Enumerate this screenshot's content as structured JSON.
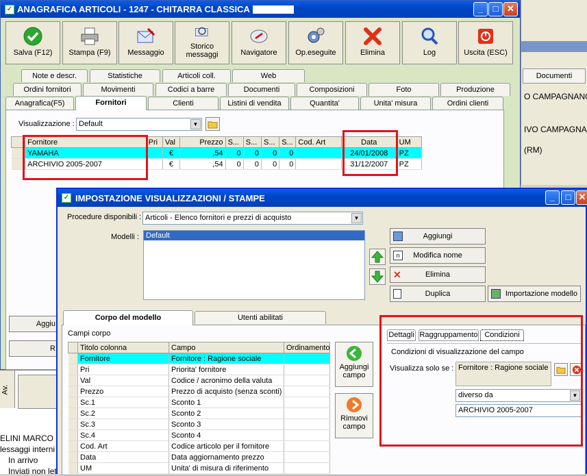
{
  "main_window": {
    "title": "ANAGRAFICA ARTICOLI - 1247 - CHITARRA CLASSICA",
    "toolbar": [
      {
        "label": "Salva (F12)",
        "icon": "check-icon"
      },
      {
        "label": "Stampa (F9)",
        "icon": "printer-icon"
      },
      {
        "label": "Messaggio",
        "icon": "envelope-pen-icon"
      },
      {
        "label": "Storico messaggi",
        "icon": "envelope-search-icon"
      },
      {
        "label": "Navigatore",
        "icon": "compass-icon"
      },
      {
        "label": "Op.eseguite",
        "icon": "gear-icon"
      },
      {
        "label": "Elimina",
        "icon": "x-icon"
      },
      {
        "label": "Log",
        "icon": "magnifier-icon"
      },
      {
        "label": "Uscita (ESC)",
        "icon": "power-icon"
      }
    ],
    "tabs_row1": [
      "Note e descr.",
      "Statistiche",
      "Articoli coll.",
      "Web"
    ],
    "tabs_row2": [
      "Ordini fornitori",
      "Movimenti",
      "Codici a barre",
      "Documenti",
      "Composizioni",
      "Foto",
      "Produzione"
    ],
    "tabs_row3": [
      "Anagrafica(F5)",
      "Fornitori",
      "Clienti",
      "Listini di vendita",
      "Quantita'",
      "Unita' misura",
      "Ordini clienti"
    ],
    "visualizzazione_label": "Visualizzazione :",
    "visualizzazione_value": "Default",
    "grid_headers": [
      "Fornitore",
      "Pri",
      "Val",
      "Prezzo",
      "S...",
      "S...",
      "S...",
      "S...",
      "Cod. Art",
      "Data",
      "UM"
    ],
    "grid_rows": [
      [
        "YAMAHA",
        "",
        "€",
        ",54",
        "0",
        "0",
        "0",
        "0",
        "",
        "24/01/2008",
        "PZ"
      ],
      [
        "ARCHIVIO 2005-2007",
        "",
        "€",
        ",54",
        "0",
        "0",
        "0",
        "0",
        "",
        "31/12/2007",
        "PZ"
      ]
    ],
    "side_buttons": [
      "Aggiu",
      "R"
    ]
  },
  "background_window": {
    "documenti_label": "Documenti",
    "lines": [
      "O CAMPAGNANO",
      "IVO CAMPAGNAN",
      "(RM)"
    ]
  },
  "bottom_left": {
    "av_label": "Av.",
    "lines": [
      "ELINI MARCO",
      "lessaggi interni",
      "In arrivo",
      "Inviati non letti"
    ]
  },
  "dialog": {
    "title": "IMPOSTAZIONE VISUALIZZAZIONI / STAMPE",
    "procedure_label": "Procedure disponibili :",
    "procedure_value": "Articoli - Elenco fornitori e prezzi di acquisto",
    "modelli_label": "Modelli :",
    "modelli_items": [
      "Default"
    ],
    "buttons": {
      "aggiungi": "Aggiungi",
      "modifica_nome": "Modifica nome",
      "elimina": "Elimina",
      "duplica": "Duplica",
      "importazione": "Importazione modello"
    },
    "tabs": [
      "Corpo del modello",
      "Utenti abilitati"
    ],
    "campi_corpo_label": "Campi corpo",
    "columns": [
      "Titolo colonna",
      "Campo",
      "Ordinamento"
    ],
    "rows": [
      [
        "Fornitore",
        "Fornitore : Ragione sociale",
        ""
      ],
      [
        "Pri",
        "Priorita' fornitore",
        ""
      ],
      [
        "Val",
        "Codice / acronimo della valuta",
        ""
      ],
      [
        "Prezzo",
        "Prezzo di acquisto (senza sconti)",
        ""
      ],
      [
        "Sc.1",
        "Sconto 1",
        ""
      ],
      [
        "Sc.2",
        "Sconto 2",
        ""
      ],
      [
        "Sc.3",
        "Sconto 3",
        ""
      ],
      [
        "Sc.4",
        "Sconto 4",
        ""
      ],
      [
        "Cod. Art",
        "Codice articolo per il fornitore",
        ""
      ],
      [
        "Data",
        "Data aggiornamento prezzo",
        ""
      ],
      [
        "UM",
        "Unita' di misura di riferimento",
        ""
      ]
    ],
    "aggiungi_campo": "Aggiungi campo",
    "rimuovi_campo": "Rimuovi campo",
    "right_tabs": [
      "Dettagli",
      "Raggruppamento",
      "Condizioni"
    ],
    "condizioni_title": "Condizioni di visualizzazione del campo",
    "visualizza_label": "Visualizza solo se :",
    "visualizza_value": "Fornitore : Ragione sociale",
    "operator_value": "diverso da",
    "condition_value": "ARCHIVIO 2005-2007"
  }
}
